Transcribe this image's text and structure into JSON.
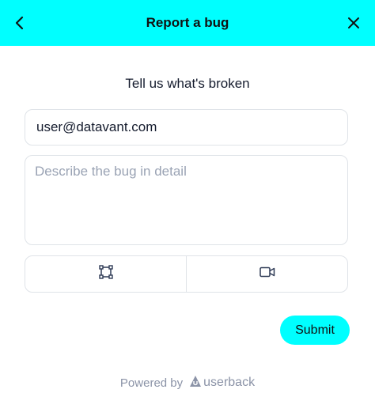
{
  "header": {
    "title": "Report a bug",
    "back_icon": "chevron-left-icon",
    "close_icon": "close-icon",
    "bg_color": "#00ffff"
  },
  "form": {
    "subtitle": "Tell us what's broken",
    "email_value": "user@datavant.com",
    "description_placeholder": "Describe the bug in detail",
    "capture_buttons": [
      {
        "icon": "screenshot-crop-icon"
      },
      {
        "icon": "video-camera-icon"
      }
    ],
    "submit_label": "Submit",
    "accent_color": "#00ffff"
  },
  "footer": {
    "powered_by": "Powered by",
    "brand": "userback",
    "brand_icon": "userback-logo-icon"
  }
}
